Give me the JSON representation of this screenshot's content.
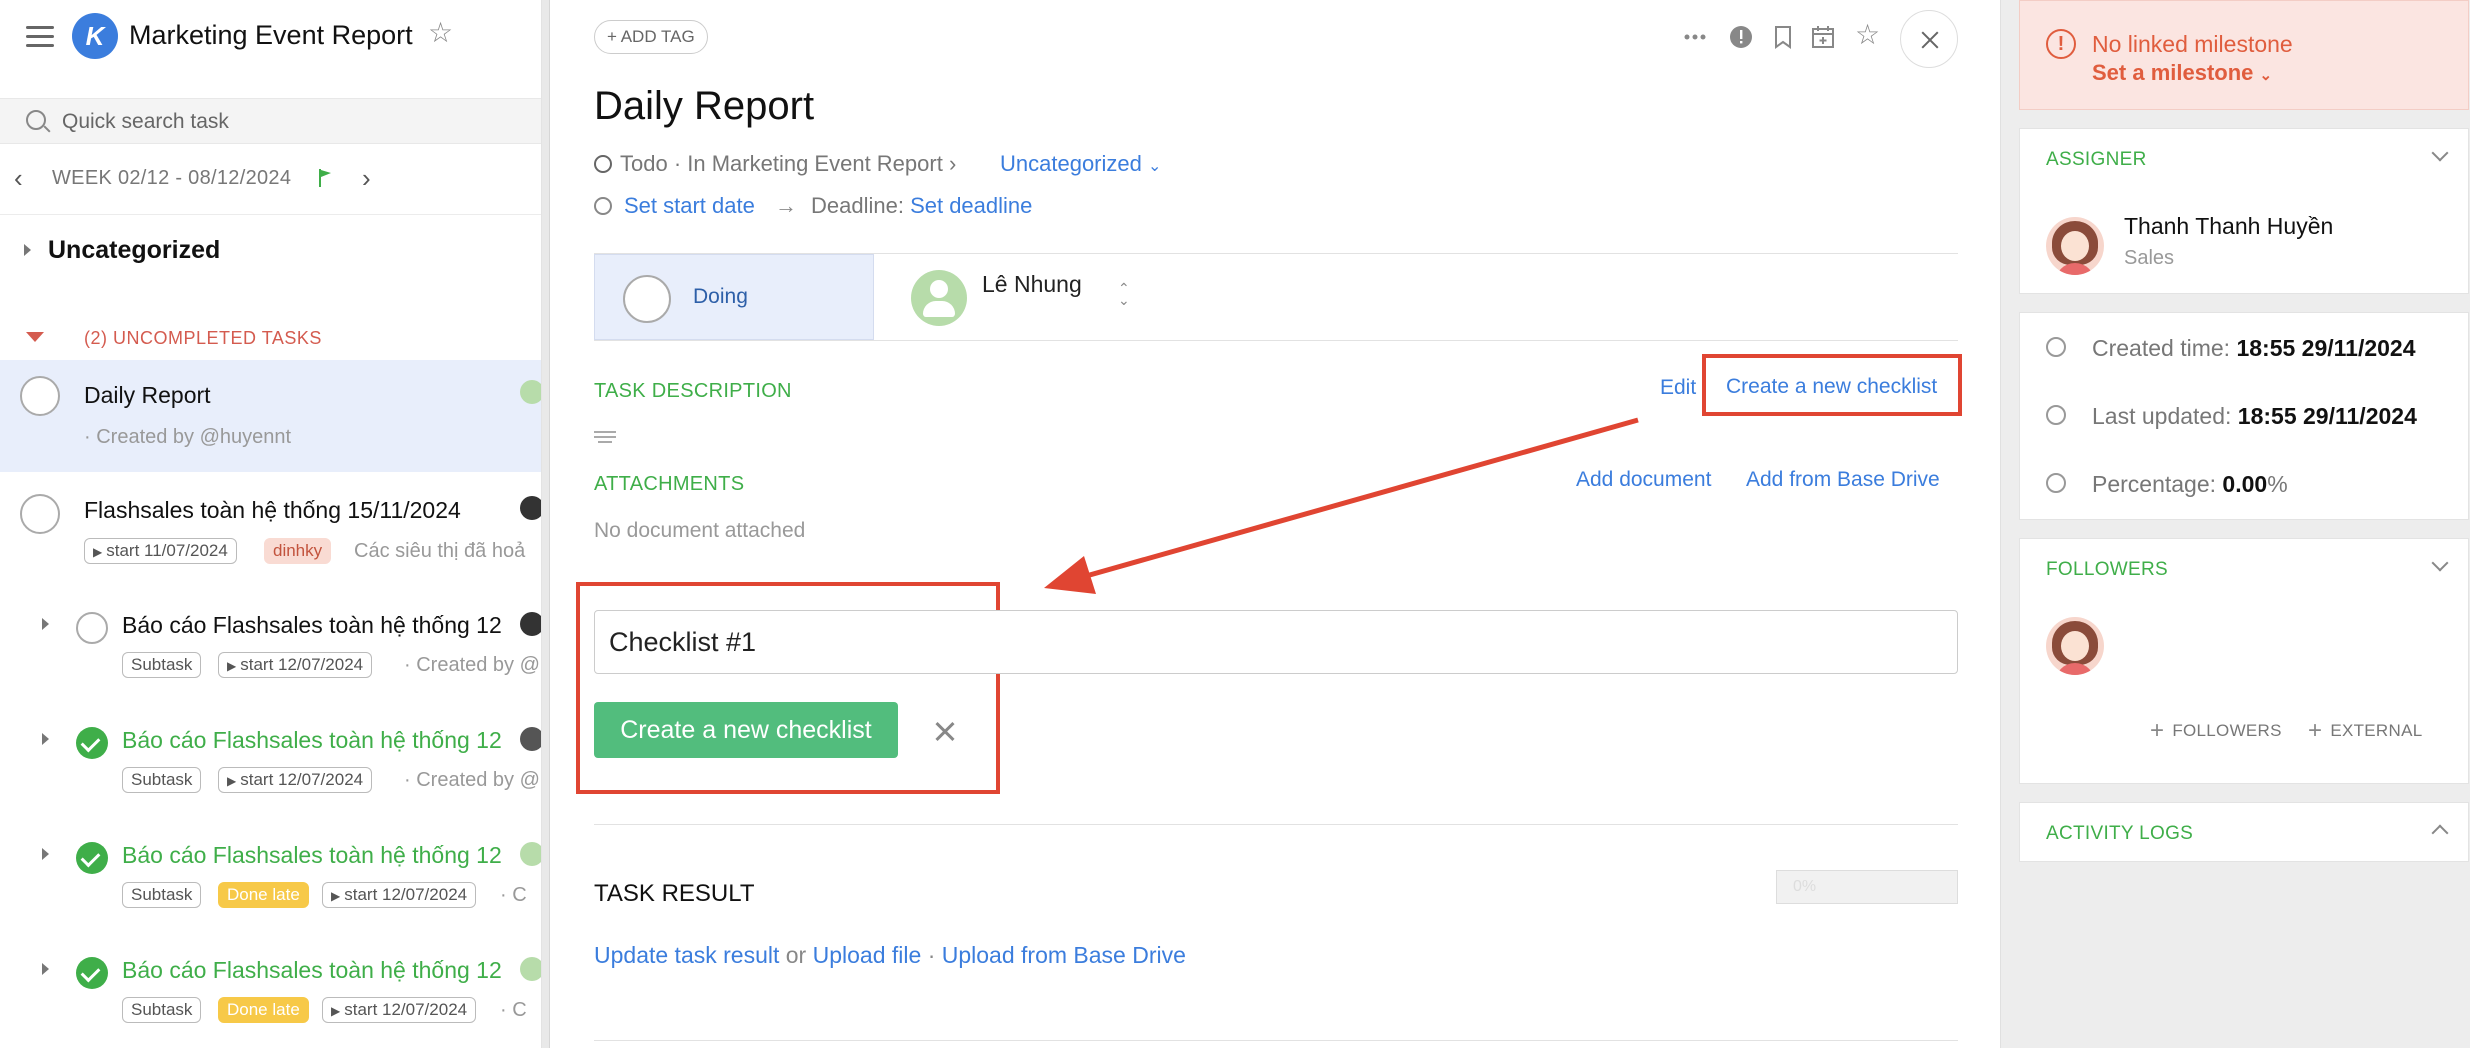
{
  "header": {
    "app_title": "Marketing Event Report",
    "search_placeholder": "Quick search task",
    "week_label": "WEEK 02/12 - 08/12/2024"
  },
  "left": {
    "section_title": "Uncategorized",
    "uncompleted_label": "(2) UNCOMPLETED TASKS",
    "tasks": [
      {
        "title": "Daily Report",
        "sub": "· Created by @huyennt"
      },
      {
        "title": "Flashsales toàn hệ thống 15/11/2024",
        "start": "start 11/07/2024",
        "tag": "dinhky",
        "sub": "Các siêu thị đã hoả"
      },
      {
        "title": "Báo cáo Flashsales toàn hệ thống 12",
        "chip": "Subtask",
        "start": "start 12/07/2024",
        "sub": "· Created by @"
      },
      {
        "title": "Báo cáo Flashsales toàn hệ thống 12",
        "chip": "Subtask",
        "start": "start 12/07/2024",
        "sub": "· Created by @"
      },
      {
        "title": "Báo cáo Flashsales toàn hệ thống 12",
        "chip": "Subtask",
        "late": "Done late",
        "start": "start 12/07/2024",
        "sub": "· C"
      },
      {
        "title": "Báo cáo Flashsales toàn hệ thống 12",
        "chip": "Subtask",
        "late": "Done late",
        "start": "start 12/07/2024",
        "sub": "· C"
      }
    ]
  },
  "main": {
    "add_tag": "ADD TAG",
    "title": "Daily Report",
    "status_line": "Todo · In Marketing Event Report",
    "category": "Uncategorized",
    "set_start": "Set start date",
    "deadline_label": "Deadline:",
    "set_deadline": "Set deadline",
    "doing": "Doing",
    "assignee": "Lê Nhung",
    "task_description": "TASK DESCRIPTION",
    "edit": "Edit",
    "create_checklist_link": "Create a new checklist",
    "attachments": "ATTACHMENTS",
    "add_document": "Add document",
    "add_from_drive": "Add from Base Drive",
    "no_document": "No document attached",
    "checklist_value": "Checklist #1",
    "create_checklist_btn": "Create a new checklist",
    "task_result": "TASK RESULT",
    "progress": "0%",
    "update_result": "Update task result",
    "or": "or",
    "upload_file": "Upload file",
    "dot": "·",
    "upload_drive": "Upload from Base Drive"
  },
  "right": {
    "milestone_title": "No linked milestone",
    "milestone_link": "Set a milestone",
    "assigner_title": "ASSIGNER",
    "assigner_name": "Thanh Thanh Huyền",
    "assigner_role": "Sales",
    "created_label": "Created time:",
    "created_value": "18:55 29/11/2024",
    "updated_label": "Last updated:",
    "updated_value": "18:55 29/11/2024",
    "percentage_label": "Percentage:",
    "percentage_value": "0.00",
    "percentage_unit": "%",
    "followers_title": "FOLLOWERS",
    "followers_btn": "FOLLOWERS",
    "external_btn": "EXTERNAL",
    "activity_title": "ACTIVITY LOGS"
  },
  "colors": {
    "accent_blue": "#3b7ddd",
    "green": "#3fae49",
    "annotation_red": "#e04532",
    "button_green": "#52bd7d"
  },
  "icons": [
    "menu-icon",
    "logo-icon",
    "star-icon",
    "search-icon",
    "chevron-left-icon",
    "chevron-right-icon",
    "flag-icon",
    "more-icon",
    "info-icon",
    "bookmark-icon",
    "calendar-icon",
    "close-icon",
    "clock-icon",
    "arrow-right-icon",
    "drag-handle-icon",
    "warning-icon",
    "user-icon",
    "check-circle-icon"
  ]
}
